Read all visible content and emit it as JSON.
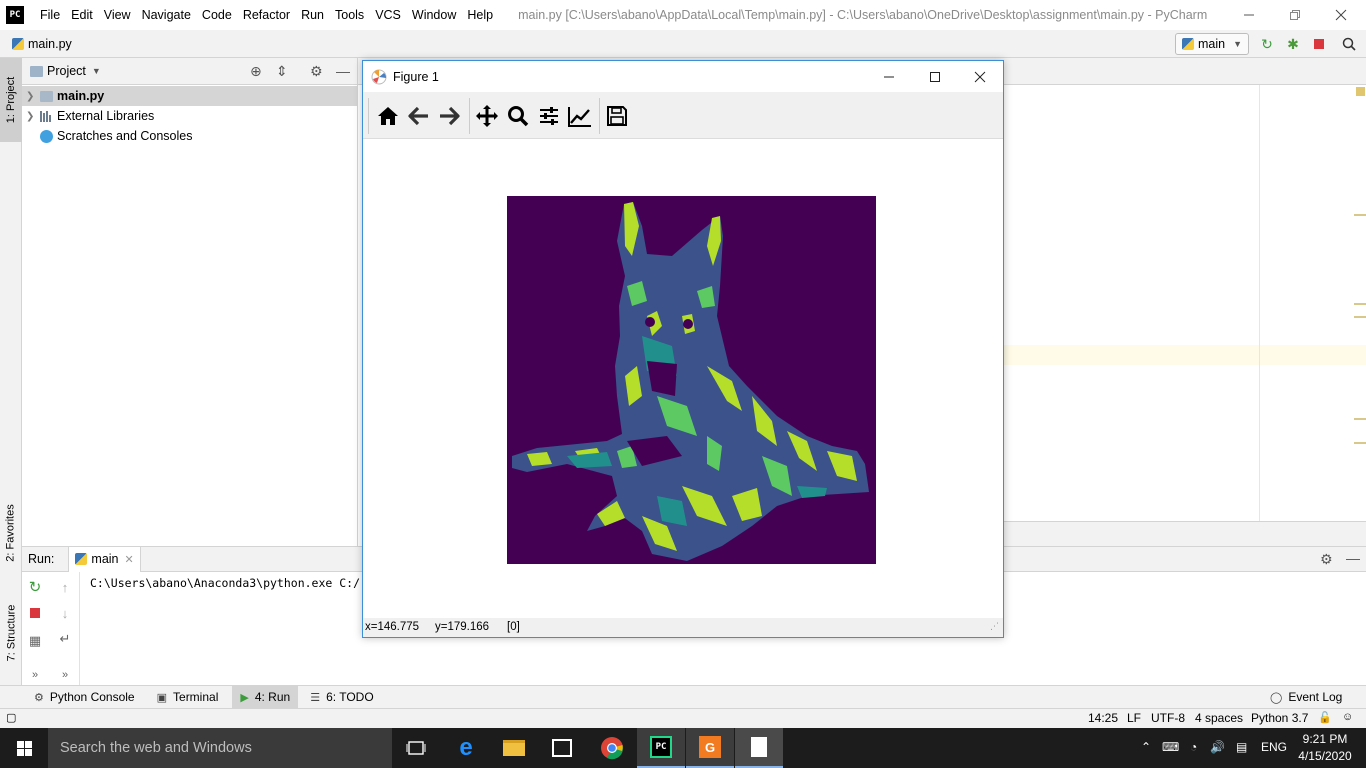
{
  "titlebar": {
    "menus": [
      "File",
      "Edit",
      "View",
      "Navigate",
      "Code",
      "Refactor",
      "Run",
      "Tools",
      "VCS",
      "Window",
      "Help"
    ],
    "title": "main.py [C:\\Users\\abano\\AppData\\Local\\Temp\\main.py] - C:\\Users\\abano\\OneDrive\\Desktop\\assignment\\main.py - PyCharm"
  },
  "navbar": {
    "file": "main.py",
    "run_config": "main"
  },
  "left_strip": {
    "tab_project": "1: Project",
    "tab_favorites": "2: Favorites",
    "tab_structure": "7: Structure"
  },
  "project_panel": {
    "header": "Project",
    "items": [
      {
        "label": "main.py",
        "selected": true
      },
      {
        "label": "External Libraries",
        "selected": false
      },
      {
        "label": "Scratches and Consoles",
        "selected": false
      }
    ]
  },
  "run_panel": {
    "label": "Run:",
    "tab": "main",
    "console_line": "C:\\Users\\abano\\Anaconda3\\python.exe C:/"
  },
  "bottom_tabs": {
    "python_console": "Python Console",
    "terminal": "Terminal",
    "run": "4: Run",
    "todo": "6: TODO",
    "event_log": "Event Log"
  },
  "statusbar": {
    "position": "14:25",
    "line_sep": "LF",
    "encoding": "UTF-8",
    "indent": "4 spaces",
    "interpreter": "Python 3.7"
  },
  "figure": {
    "title": "Figure 1",
    "status_x": "x=146.775",
    "status_y": "y=179.166",
    "status_val": "[0]",
    "colormap": [
      "#440154",
      "#3b528b",
      "#21908d",
      "#5dc963",
      "#b5de2b"
    ]
  },
  "taskbar": {
    "search_placeholder": "Search the web and Windows",
    "language": "ENG",
    "time": "9:21 PM",
    "date": "4/15/2020"
  }
}
